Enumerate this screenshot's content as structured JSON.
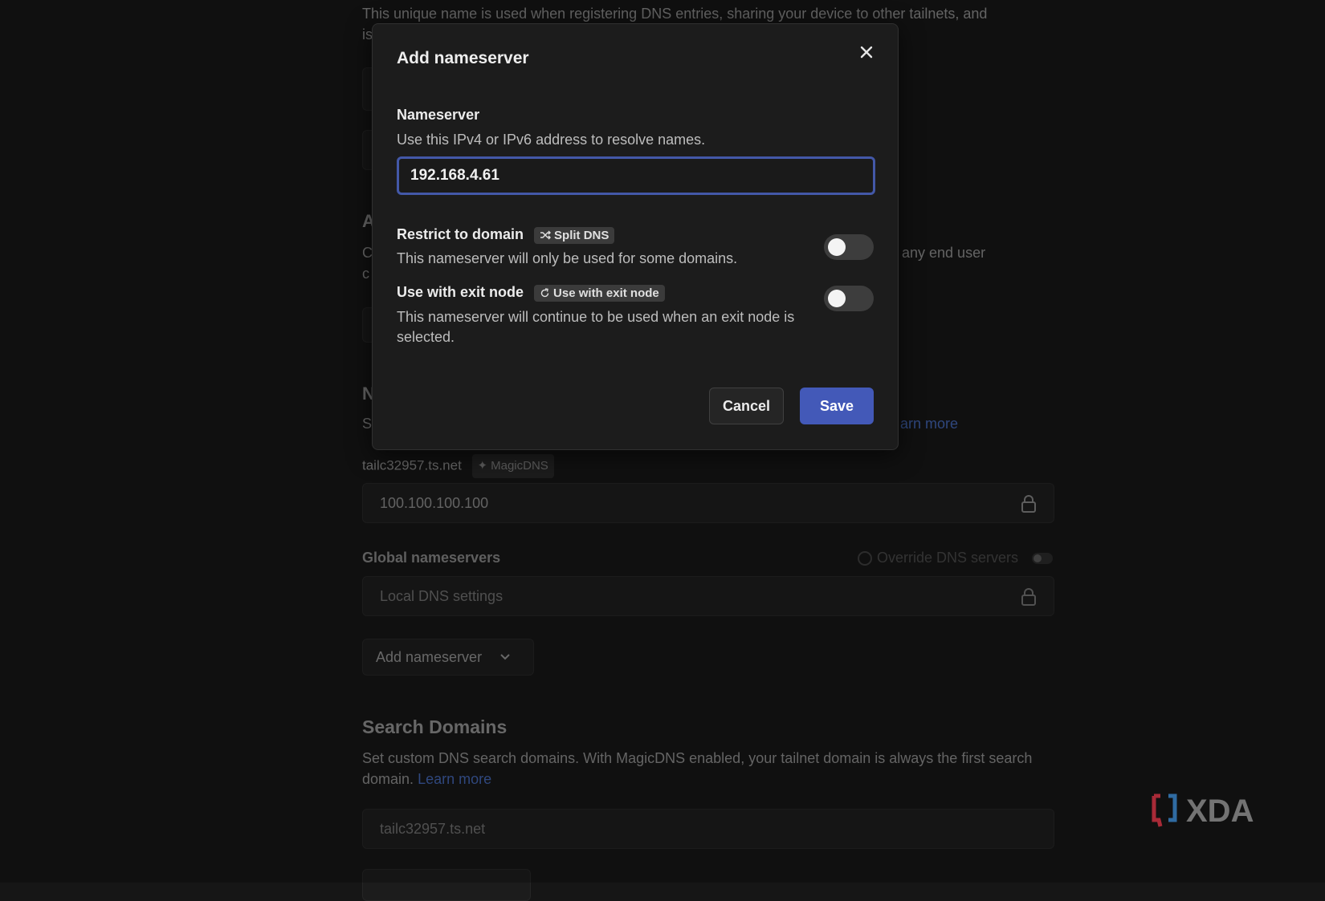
{
  "background": {
    "top_desc_line1": "This unique name is used when registering DNS entries, sharing your device to other tailnets, and",
    "top_desc_line2": "is",
    "frag_a": "A",
    "frag_c1": "C",
    "frag_c2": "c",
    "right_text": "any end user",
    "frag_n": "N",
    "frag_s": "S",
    "learn_more_partial": "arn more",
    "tailnet_name": "tailc32957.ts.net",
    "magicdns_badge": "MagicDNS",
    "magicdns_ip": "100.100.100.100",
    "global_nameservers_label": "Global nameservers",
    "override_dns_label": "Override DNS servers",
    "local_dns_settings": "Local DNS settings",
    "add_nameserver_button": "Add nameserver",
    "search_domains_title": "Search Domains",
    "search_domains_desc_line1": "Set custom DNS search domains. With MagicDNS enabled, your tailnet domain is always the first search",
    "search_domains_desc_line2": "domain.",
    "search_domains_learn_more": "Learn more",
    "search_domain_value": "tailc32957.ts.net"
  },
  "modal": {
    "title": "Add nameserver",
    "nameserver_label": "Nameserver",
    "nameserver_desc": "Use this IPv4 or IPv6 address to resolve names.",
    "nameserver_value": "192.168.4.61",
    "restrict_label": "Restrict to domain",
    "restrict_badge": "Split DNS",
    "restrict_desc": "This nameserver will only be used for some domains.",
    "restrict_enabled": false,
    "exit_label": "Use with exit node",
    "exit_badge": "Use with exit node",
    "exit_desc_line1": "This nameserver will continue to be used when an exit node is",
    "exit_desc_line2": "selected.",
    "exit_enabled": false,
    "cancel_label": "Cancel",
    "save_label": "Save"
  },
  "watermark": {
    "text": "XDA",
    "accent": "#e0394a"
  },
  "colors": {
    "primary": "#4359b8",
    "focus_border": "#4358a8",
    "link": "#3f5fa8"
  }
}
